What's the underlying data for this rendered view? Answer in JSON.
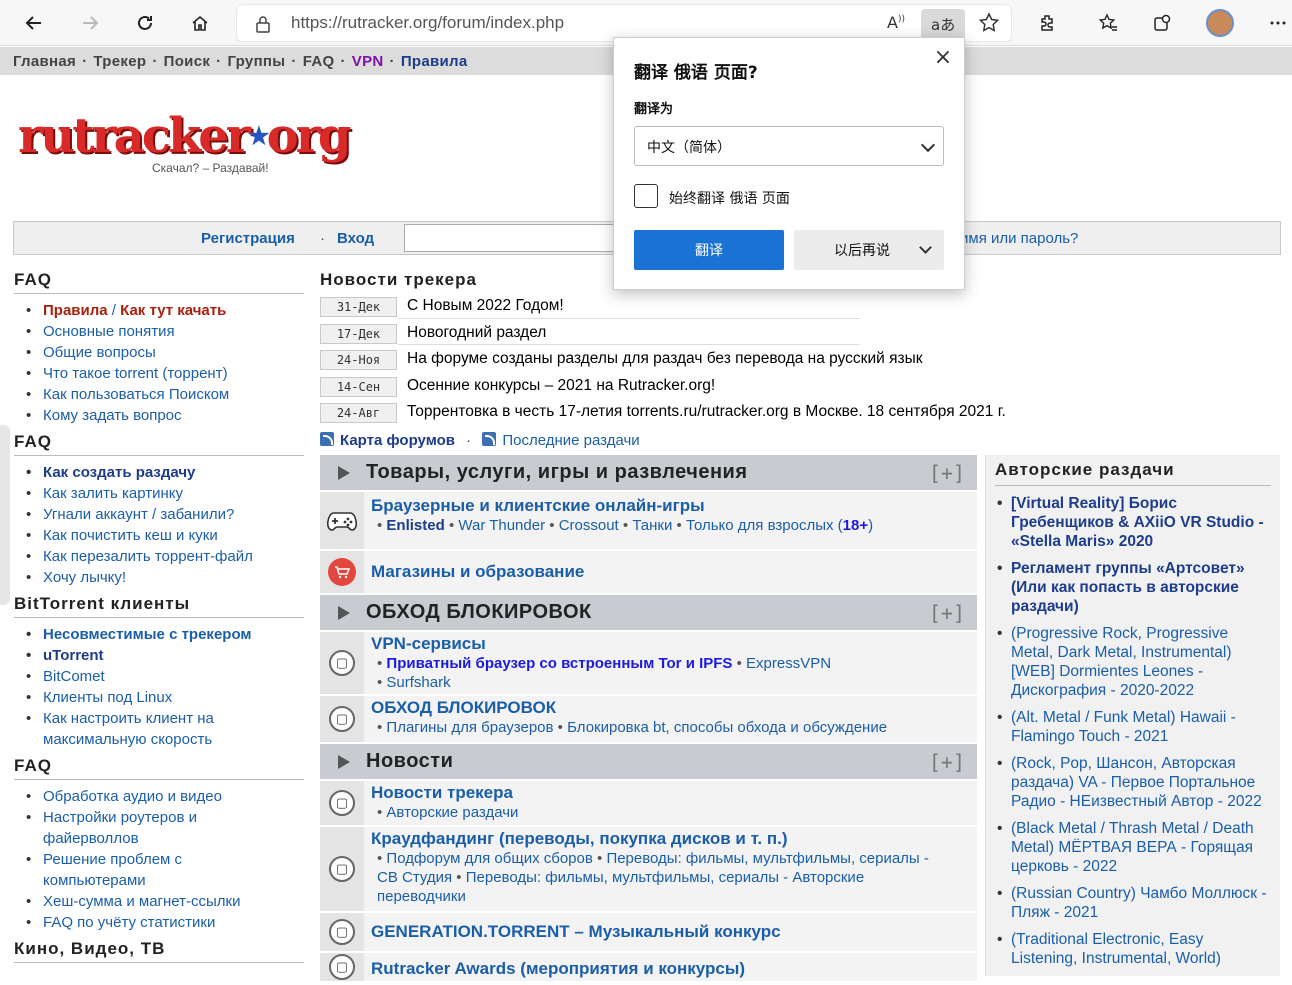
{
  "browser": {
    "url": "https://rutracker.org/forum/index.php"
  },
  "topnav": {
    "home": "Главная",
    "tracker": "Трекер",
    "search": "Поиск",
    "groups": "Группы",
    "faq": "FAQ",
    "vpn": "VPN",
    "rules": "Правила",
    "sep": "·"
  },
  "logo": {
    "text": "rutracker",
    "star": "★",
    "suffix": "org",
    "slogan": "Скачал? – Раздавай!"
  },
  "login": {
    "register": "Регистрация",
    "sep": "·",
    "enter": "Вход",
    "forgot": "имя или пароль?"
  },
  "sidebar": {
    "sections": [
      {
        "title": "FAQ",
        "items": [
          {
            "label": "Правила",
            "label2": "Как тут качать"
          },
          {
            "label": "Основные понятия"
          },
          {
            "label": "Общие вопросы"
          },
          {
            "label": "Что такое torrent (торрент)"
          },
          {
            "label": "Как пользоваться Поиском"
          },
          {
            "label": "Кому задать вопрос"
          }
        ]
      },
      {
        "title": "FAQ",
        "items": [
          {
            "label": "Как создать раздачу"
          },
          {
            "label": "Как залить картинку"
          },
          {
            "label": "Угнали аккаунт / забанили?"
          },
          {
            "label": "Как почистить кеш и куки"
          },
          {
            "label": "Как перезалить торрент-файл"
          },
          {
            "label": "Хочу лычку!"
          }
        ]
      },
      {
        "title": "BitTorrent клиенты",
        "items": [
          {
            "label": "Несовместимые с трекером"
          },
          {
            "label": "uTorrent"
          },
          {
            "label": "BitComet"
          },
          {
            "label": "Клиенты под Linux"
          },
          {
            "label": "Как настроить клиент на максимальную скорость"
          }
        ]
      },
      {
        "title": "FAQ",
        "items": [
          {
            "label": "Обработка аудио и видео"
          },
          {
            "label": "Настройки роутеров и файерволлов"
          },
          {
            "label": "Решение проблем с компьютерами"
          },
          {
            "label": "Хеш-сумма и магнет-ссылки"
          },
          {
            "label": "FAQ по учёту статистики"
          }
        ]
      },
      {
        "title": "Кино, Видео, ТВ"
      }
    ]
  },
  "news": {
    "title": "Новости трекера",
    "items": [
      {
        "date": "31-Дек",
        "text": "С Новым 2022 Годом!"
      },
      {
        "date": "17-Дек",
        "text": "Новогодний раздел"
      },
      {
        "date": "24-Ноя",
        "text": "На форуме созданы разделы для раздач без перевода на русский язык"
      },
      {
        "date": "14-Сен",
        "text": "Осенние конкурсы – 2021 на Rutracker.org!"
      },
      {
        "date": "24-Авг",
        "text": "Торрентовка в честь 17-летия torrents.ru/rutracker.org в Москве. 18 сентября 2021 г."
      }
    ],
    "map": "Карта форумов",
    "dot": "·",
    "latest": "Последние раздачи"
  },
  "forum": {
    "plus": "[+]",
    "cat1": "Товары, услуги, игры и развлечения",
    "f1": {
      "name": "Браузерные и клиентские онлайн-игры",
      "s1": "Enlisted",
      "s2": "War Thunder",
      "s3": "Crossout",
      "s4": "Танки",
      "s5": "Только для взрослых (",
      "s6": "18+",
      "s7": ")"
    },
    "f2": {
      "name": "Магазины и образование"
    },
    "cat2": "ОБХОД БЛОКИРОВОК",
    "f3": {
      "name": "VPN-сервисы",
      "s1": "Приватный браузер со встроенным Tor и IPFS",
      "s2": "ExpressVPN",
      "s3": "Surfshark"
    },
    "f4": {
      "name": "ОБХОД БЛОКИРОВОК",
      "s1": "Плагины для браузеров",
      "s2": "Блокировка bt, способы обхода и обсуждение"
    },
    "cat3": "Новости",
    "f5": {
      "name": "Новости трекера",
      "s1": "Авторские раздачи"
    },
    "f6": {
      "name": "Краудфандинг (переводы, покупка дисков и т. п.)",
      "s1": "Подфорум для общих сборов",
      "s2": "Переводы: фильмы, мультфильмы, сериалы - СВ Студия",
      "s3": "Переводы: фильмы, мультфильмы, сериалы - Авторские переводчики"
    },
    "f7": {
      "name": "GENERATION.TORRENT – Музыкальный конкурс"
    },
    "f8": {
      "name": "Rutracker Awards (мероприятия и конкурсы)"
    }
  },
  "right": {
    "title": "Авторские раздачи",
    "items": [
      "[Virtual Reality] Борис Гребенщиков & AXiiO VR Studio - «Stella Maris» 2020",
      "Регламент группы «Артсовет» (Или как попасть в авторские раздачи)",
      "(Progressive Rock, Progressive Metal, Dark Metal, Instrumental) [WEB] Dormientes Leones - Дискография - 2020-2022",
      "(Alt. Metal / Funk Metal) Hawaii - Flamingo Touch - 2021",
      "(Rock, Pop, Шансон, Авторская раздача) VA - Первое Портальное Радио - НЕизвестный Автор - 2022",
      "(Black Metal / Thrash Metal / Death Metal) МЁРТВАЯ ВЕРА - Горящая церковь - 2022",
      "(Russian Country) Чамбо Моллюск - Пляж - 2021",
      "(Traditional Electronic, Easy Listening, Instrumental, World)"
    ]
  },
  "popup": {
    "title": "翻译 俄语 页面?",
    "label": "翻译为",
    "lang": "中文（简体）",
    "always": "始终翻译 俄语 页面",
    "translate": "翻译",
    "later": "以后再说",
    "close": "×"
  }
}
